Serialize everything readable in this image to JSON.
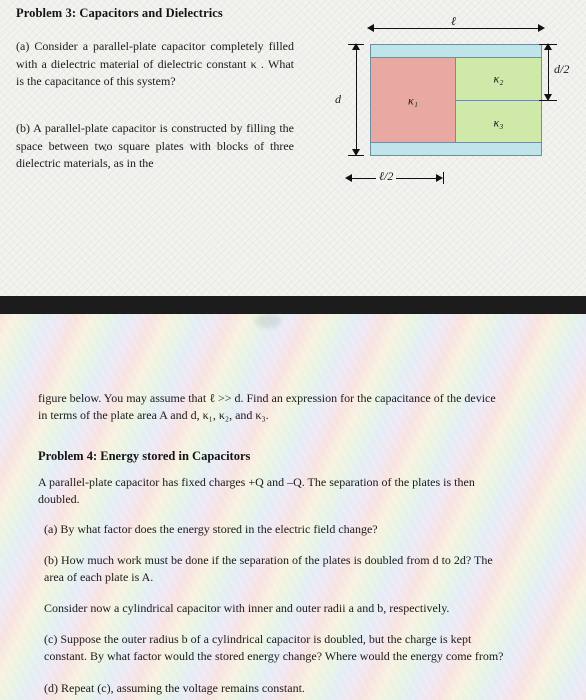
{
  "top": {
    "problem3_title": "Problem 3: Capacitors and Dielectrics",
    "part_a": "(a) Consider a parallel-plate capacitor completely filled with a dielectric material of dielectric constant κ . What is the capacitance of this system?",
    "part_b": "(b) A parallel-plate capacitor is constructed by filling the space between two square plates with blocks of three dielectric materials, as in the"
  },
  "figure": {
    "length_label": "ℓ",
    "half_length_label": "ℓ/2",
    "gap_label": "d",
    "half_gap_label": "d/2",
    "block1_label": "κ₁",
    "block2_label": "κ₂",
    "block3_label": "κ₃",
    "colors": {
      "plate": "#bfe4ea",
      "block1": "#e8a9a2",
      "block2": "#cfe9a8",
      "block3": "#cfe9a8",
      "outline": "#6f8fa0"
    }
  },
  "bottom": {
    "continuation": "figure below. You may assume that ℓ >> d. Find an expression for the capacitance of the device in terms of the plate area A and d, κ₁, κ₂, and κ₃.",
    "problem4_title": "Problem 4: Energy stored in Capacitors",
    "p4_intro": "A parallel-plate capacitor has fixed charges +Q and –Q. The separation of the plates is then doubled.",
    "p4_a": "(a) By what factor does the energy stored in the electric field change?",
    "p4_b": "(b) How much work must be done if the separation of the plates is doubled from d to 2d? The area of each plate is A.",
    "p4_cyl": "Consider now a cylindrical capacitor with inner and outer radii a and b, respectively.",
    "p4_c": "(c) Suppose the outer radius b of a cylindrical capacitor is doubled, but the charge is kept constant. By what factor would the stored energy change? Where would the energy come from?",
    "p4_d": "(d) Repeat (c), assuming the voltage remains constant."
  }
}
